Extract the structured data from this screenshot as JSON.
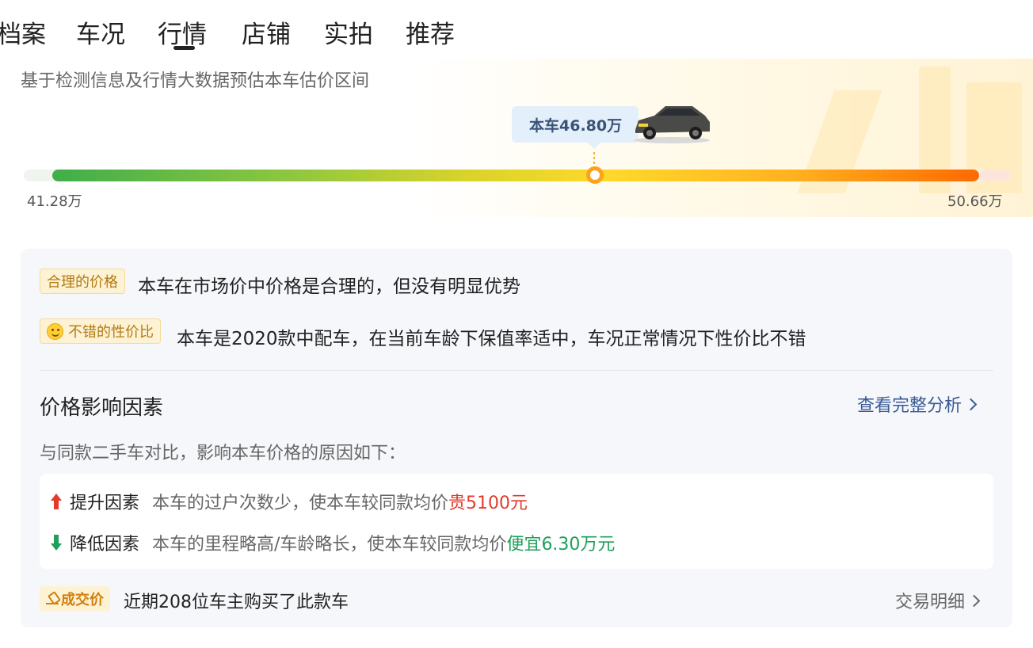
{
  "tabs": [
    {
      "label": "档案",
      "active": false
    },
    {
      "label": "车况",
      "active": false
    },
    {
      "label": "行情",
      "active": true
    },
    {
      "label": "店铺",
      "active": false
    },
    {
      "label": "实拍",
      "active": false
    },
    {
      "label": "推荐",
      "active": false
    }
  ],
  "estimate": {
    "subtitle": "基于检测信息及行情大数据预估本车估价区间",
    "current_price_label": "本车46.80万",
    "min_label": "41.28万",
    "max_label": "50.66万",
    "marker_position_fraction": 0.588
  },
  "verdicts": [
    {
      "badge": "合理的价格",
      "text": "本车在市场价中价格是合理的，但没有明显优势"
    },
    {
      "badge": "不错的性价比",
      "icon": "smile-icon",
      "text": "本车是2020款中配车，在当前车龄下保值率适中，车况正常情况下性价比不错"
    }
  ],
  "factors_section": {
    "title": "价格影响因素",
    "link_label": "查看完整分析",
    "description": "与同款二手车对比，影响本车价格的原因如下：",
    "up": {
      "label": "提升因素",
      "desc": "本车的过户次数少，使本车较同款均价",
      "highlight": "贵5100元"
    },
    "down": {
      "label": "降低因素",
      "desc": "本车的里程略高/车龄略长，使本车较同款均价",
      "highlight": "便宜6.30万元"
    }
  },
  "deal": {
    "badge": "成交价",
    "text": "近期208位车主购买了此款车",
    "link_label": "交易明细"
  },
  "colors": {
    "accent_blue": "#3a5a96",
    "raise_red": "#e23b2d",
    "lower_green": "#1e9f5a",
    "badge_gold": "#b37a12"
  }
}
